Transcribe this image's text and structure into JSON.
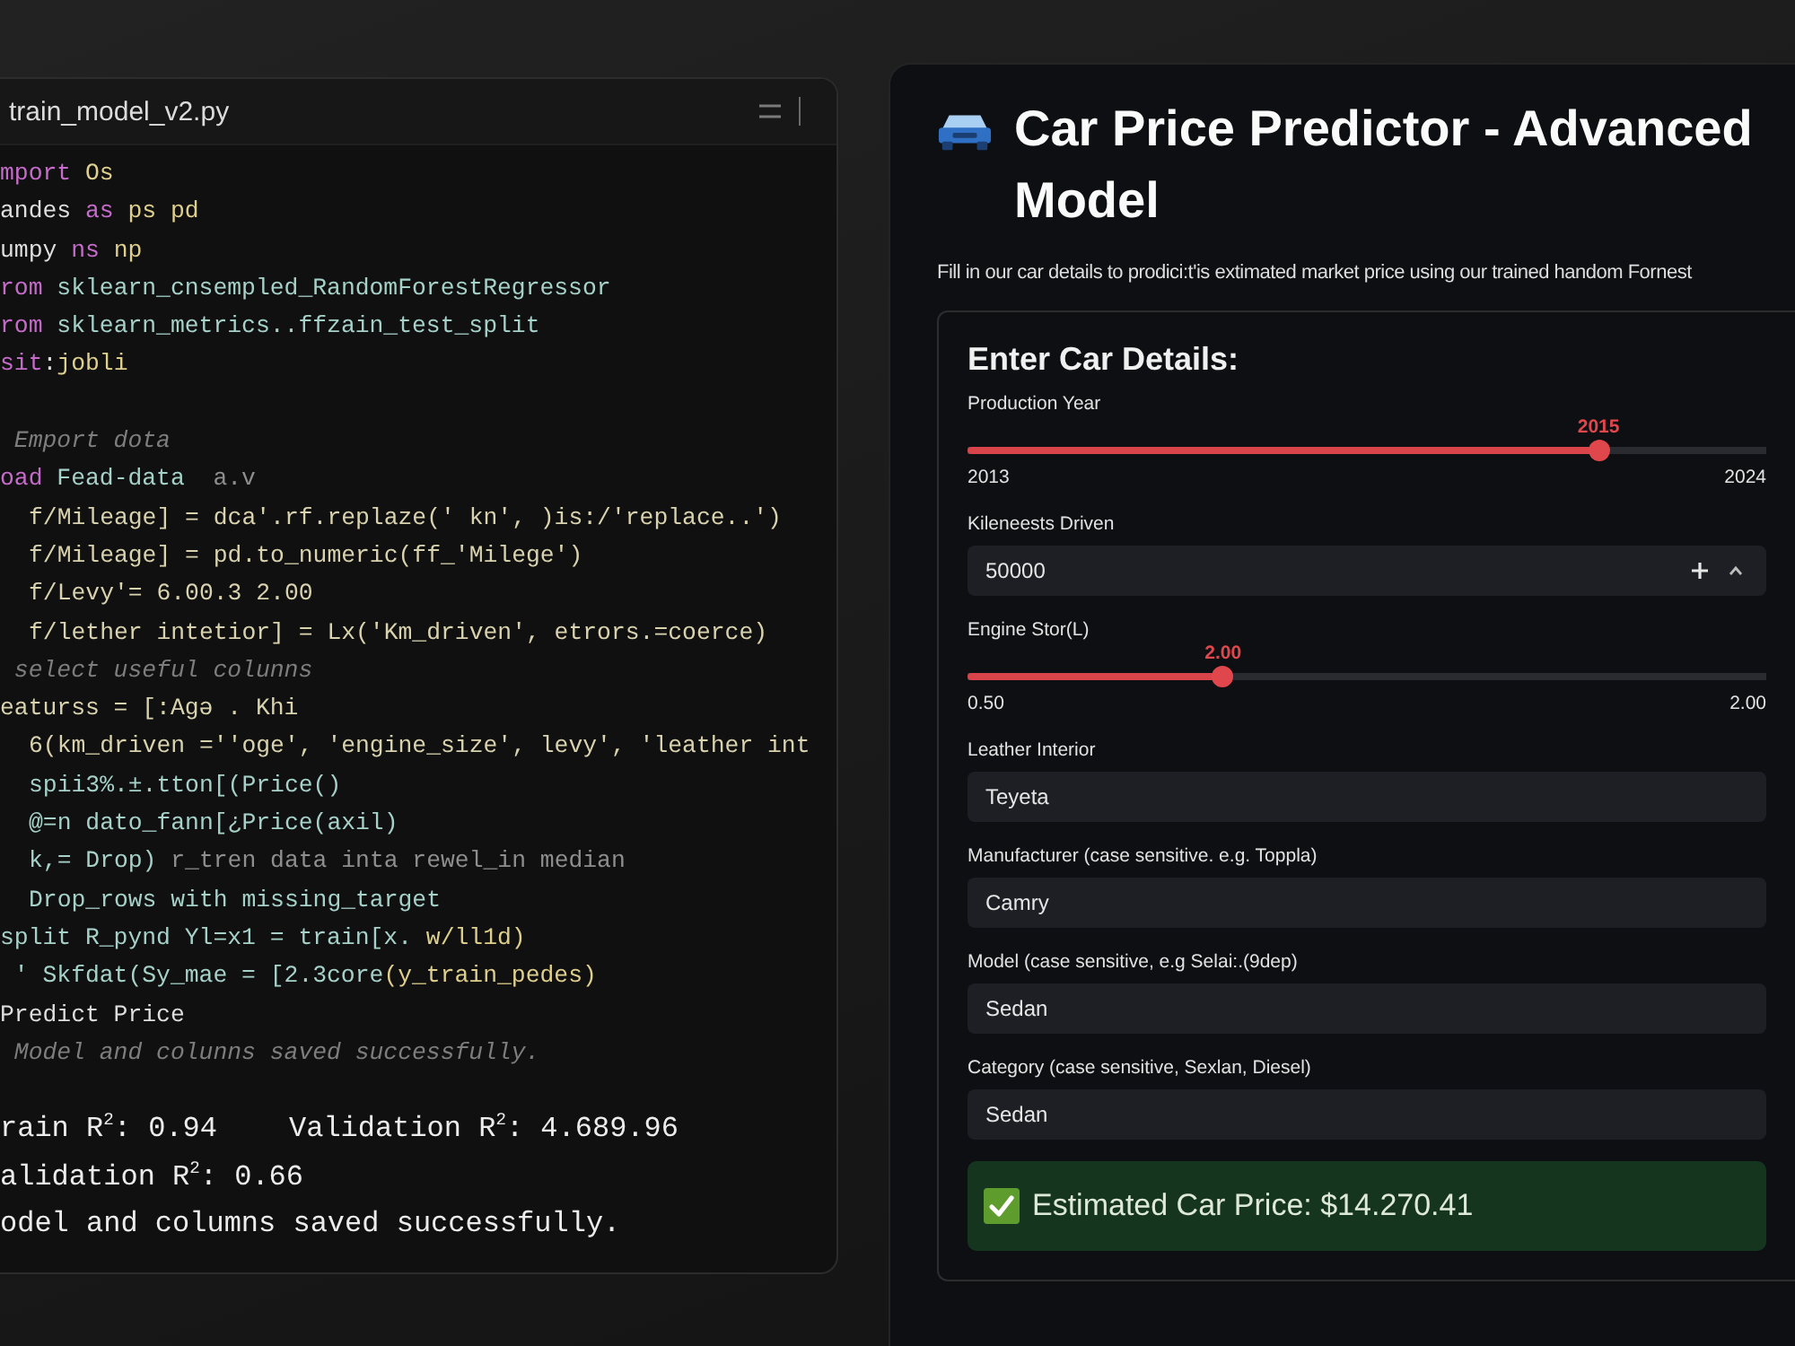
{
  "editor": {
    "title": "train_model_v2.py",
    "lines": [
      {
        "indented": false,
        "blank_before": false,
        "segments": [
          {
            "text": "mport",
            "kind": "keyword"
          },
          {
            "text": " Os",
            "kind": "module"
          }
        ]
      },
      {
        "indented": false,
        "blank_before": false,
        "segments": [
          {
            "text": "andes",
            "kind": "name"
          },
          {
            "text": " as",
            "kind": "keyword"
          },
          {
            "text": " ps pd",
            "kind": "module"
          }
        ]
      },
      {
        "indented": false,
        "blank_before": false,
        "segments": [
          {
            "text": "umpy",
            "kind": "name"
          },
          {
            "text": " ns",
            "kind": "keyword"
          },
          {
            "text": " np",
            "kind": "module"
          }
        ]
      },
      {
        "indented": false,
        "blank_before": false,
        "segments": [
          {
            "text": "rom",
            "kind": "keyword"
          },
          {
            "text": " sklearn_cnsempled_RandomForestRegressor",
            "kind": "ident"
          }
        ]
      },
      {
        "indented": false,
        "blank_before": false,
        "segments": [
          {
            "text": "rom",
            "kind": "keyword"
          },
          {
            "text": " sklearn_metrics..ffzain_test_split",
            "kind": "ident"
          }
        ]
      },
      {
        "indented": false,
        "blank_before": false,
        "segments": [
          {
            "text": "sit",
            "kind": "keyword"
          },
          {
            "text": ":",
            "kind": "name"
          },
          {
            "text": "jobli",
            "kind": "module"
          }
        ]
      },
      {
        "indented": false,
        "blank_before": true,
        "segments": [
          {
            "text": " Emport dota",
            "kind": "comment"
          }
        ]
      },
      {
        "indented": false,
        "blank_before": false,
        "segments": [
          {
            "text": "oad",
            "kind": "keyword"
          },
          {
            "text": " Fead-data",
            "kind": "ident"
          },
          {
            "text": "  a.v",
            "kind": "muted"
          }
        ]
      },
      {
        "indented": true,
        "blank_before": false,
        "segments": [
          {
            "text": "f/Mileage] = dca'.rf.replaze(' kn', )is:/'replace..')",
            "kind": "plain"
          }
        ]
      },
      {
        "indented": true,
        "blank_before": false,
        "segments": [
          {
            "text": "f/Mileage] = pd.to_numeric(ff_'Milege')",
            "kind": "plain"
          }
        ]
      },
      {
        "indented": true,
        "blank_before": false,
        "segments": [
          {
            "text": "f/Levy'= 6.00.3 2.00",
            "kind": "plain"
          }
        ]
      },
      {
        "indented": true,
        "blank_before": false,
        "segments": [
          {
            "text": "f/lether intetior] = Lx('Km_driven', etrors.=coerce)",
            "kind": "plain"
          }
        ]
      },
      {
        "indented": false,
        "blank_before": false,
        "segments": [
          {
            "text": " select useful colunns",
            "kind": "comment"
          }
        ]
      },
      {
        "indented": false,
        "blank_before": false,
        "segments": [
          {
            "text": "eaturss = [:Agə . Khi",
            "kind": "plain"
          }
        ]
      },
      {
        "indented": true,
        "blank_before": false,
        "segments": [
          {
            "text": "6(km_driven =''oge', 'engine_size', levy', 'leather int",
            "kind": "plain"
          }
        ]
      },
      {
        "indented": true,
        "blank_before": false,
        "segments": [
          {
            "text": "spii3%.±.tton[(Price()",
            "kind": "ident"
          }
        ]
      },
      {
        "indented": true,
        "blank_before": false,
        "segments": [
          {
            "text": "@=n dato_fann[¿Price(axil)",
            "kind": "ident"
          }
        ]
      },
      {
        "indented": true,
        "blank_before": false,
        "segments": [
          {
            "text": "k,= Drop)",
            "kind": "ident"
          },
          {
            "text": " r_tren data inta rewel_in median",
            "kind": "muted"
          }
        ]
      },
      {
        "indented": true,
        "blank_before": false,
        "segments": [
          {
            "text": "Drop_rows with missing_target",
            "kind": "ident"
          }
        ]
      },
      {
        "indented": false,
        "blank_before": false,
        "segments": [
          {
            "text": "split R_pynd Yl=x1 = train[x.",
            "kind": "ident"
          },
          {
            "text": " w/ll1d)",
            "kind": "module"
          }
        ]
      },
      {
        "indented": false,
        "blank_before": false,
        "segments": [
          {
            "text": " ' Skfdat(Sy_mae = [2.3core",
            "kind": "ident"
          },
          {
            "text": "(y_train_pedes)",
            "kind": "module"
          }
        ]
      },
      {
        "indented": false,
        "blank_before": false,
        "segments": [
          {
            "text": "Predict Price",
            "kind": "name"
          }
        ]
      },
      {
        "indented": false,
        "blank_before": false,
        "segments": [
          {
            "text": " Model and colunns saved successfully.",
            "kind": "comment"
          }
        ]
      }
    ],
    "output": [
      {
        "parts": [
          "rain R$^{2}$: 0.94",
          "Validation R$^{2}$: 4.689.96"
        ]
      },
      {
        "parts": [
          "alidation R$^{2}$: 0.66"
        ]
      },
      {
        "parts": [
          "odel and columns saved successfully."
        ]
      }
    ]
  },
  "app": {
    "title": "Car Price Predictor - Advanced Model",
    "subtitle": "Fill in our car details to prodici:t'is extimated market price using our trained handom Fornest",
    "form": {
      "heading": "Enter Car Details:",
      "fields": [
        {
          "kind": "slider",
          "label": "Production Year",
          "value": "2015",
          "level": 0.79,
          "min": "2013",
          "max": "2024"
        },
        {
          "kind": "number",
          "label": "Kileneests Driven",
          "value": "50000"
        },
        {
          "kind": "slider",
          "label": "Engine Stor(L)",
          "value": "2.00",
          "level": 0.32,
          "min": "0.50",
          "max": "2.00"
        },
        {
          "kind": "text",
          "label": "Leather Interior",
          "value": "Teyeta"
        },
        {
          "kind": "text",
          "label": "Manufacturer (case sensitive. e.g. Toppla)",
          "value": "Camry"
        },
        {
          "kind": "text",
          "label": "Model (case sensitive, e.g Selai:.(9dep)",
          "value": "Sedan"
        },
        {
          "kind": "text",
          "label": "Category (case sensitive, Sexlan, Diesel)",
          "value": "Sedan"
        }
      ],
      "result": {
        "kind": "success",
        "text": "Estimated Car Price: $14.270.41"
      }
    }
  }
}
